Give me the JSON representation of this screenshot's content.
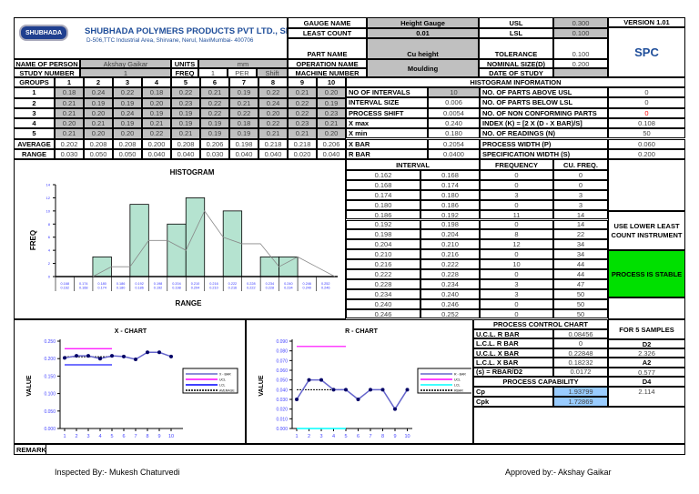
{
  "header": {
    "logo_text": "SHUBHADA",
    "company": "SHUBHADA POLYMERS PRODUCTS PVT LTD., SHIRWANE",
    "address": "D-506,TTC Industrial Area, Shirvane, Nerul, NaviMumbai- 400706",
    "name_of_person_label": "NAME OF PERSON",
    "name_of_person": "Akshay Gaikar",
    "units_label": "UNITS",
    "units": "mm",
    "study_number_label": "STUDY NUMBER",
    "study_number": "1",
    "freq_label": "FREQ",
    "freq": "1",
    "per_label": "PER",
    "per": "Shift",
    "gauge_name_label": "GAUGE NAME",
    "gauge_name": "Height Gauge",
    "least_count_label": "LEAST COUNT",
    "least_count": "0.01",
    "part_name_label": "PART NAME",
    "part_name": "Cu height",
    "operation_name_label": "OPERATION NAME",
    "machine_number_label": "MACHINE NUMBER",
    "operation_name": "Moulding",
    "usl_label": "USL",
    "usl": "0.300",
    "lsl_label": "LSL",
    "lsl": "0.100",
    "tolerance_label": "TOLERANCE",
    "tolerance": "0.100",
    "nominal_label": "NOMINAL SIZE(D)",
    "nominal": "0.200",
    "date_label": "DATE OF STUDY",
    "version": "VERSION 1.01",
    "spc": "SPC"
  },
  "groups": {
    "label": "GROUPS",
    "columns": [
      "1",
      "2",
      "3",
      "4",
      "5",
      "6",
      "7",
      "8",
      "9",
      "10"
    ],
    "rows": [
      {
        "label": "1",
        "values": [
          "0.18",
          "0.24",
          "0.22",
          "0.18",
          "0.22",
          "0.21",
          "0.19",
          "0.22",
          "0.21",
          "0.20"
        ]
      },
      {
        "label": "2",
        "values": [
          "0.21",
          "0.19",
          "0.19",
          "0.20",
          "0.23",
          "0.22",
          "0.21",
          "0.24",
          "0.22",
          "0.19"
        ]
      },
      {
        "label": "3",
        "values": [
          "0.21",
          "0.20",
          "0.24",
          "0.19",
          "0.19",
          "0.22",
          "0.22",
          "0.20",
          "0.22",
          "0.23"
        ]
      },
      {
        "label": "4",
        "values": [
          "0.20",
          "0.21",
          "0.19",
          "0.21",
          "0.19",
          "0.19",
          "0.18",
          "0.22",
          "0.23",
          "0.21"
        ]
      },
      {
        "label": "5",
        "values": [
          "0.21",
          "0.20",
          "0.20",
          "0.22",
          "0.21",
          "0.19",
          "0.19",
          "0.21",
          "0.21",
          "0.20"
        ]
      }
    ],
    "average": {
      "label": "AVERAGE",
      "values": [
        "0.202",
        "0.208",
        "0.208",
        "0.200",
        "0.208",
        "0.206",
        "0.198",
        "0.218",
        "0.218",
        "0.206"
      ]
    },
    "range": {
      "label": "RANGE",
      "values": [
        "0.030",
        "0.050",
        "0.050",
        "0.040",
        "0.040",
        "0.030",
        "0.040",
        "0.040",
        "0.020",
        "0.040"
      ]
    }
  },
  "hist_info": {
    "title": "HISTOGRAM INFORMATION",
    "left": [
      {
        "label": "NO OF INTERVALS",
        "value": "10"
      },
      {
        "label": "INTERVAL SIZE",
        "value": "0.006"
      },
      {
        "label": "PROCESS SHIFT",
        "value": "0.0054"
      },
      {
        "label": "X max",
        "value": "0.240"
      },
      {
        "label": "X min",
        "value": "0.180"
      },
      {
        "label": "X BAR",
        "value": "0.2054"
      },
      {
        "label": "R BAR",
        "value": "0.0400"
      }
    ],
    "right": [
      {
        "label": "NO. OF PARTS ABOVE USL",
        "value": "0"
      },
      {
        "label": "NO. OF PARTS BELOW LSL",
        "value": "0"
      },
      {
        "label": "NO. OF NON CONFORMING PARTS",
        "value": "0"
      },
      {
        "label": "INDEX (K) = [2 X (D - X BAR)/S]",
        "value": "0.108"
      },
      {
        "label": "NO. OF READINGS (N)",
        "value": "50"
      },
      {
        "label": "PROCESS WIDTH (P)",
        "value": "0.060"
      },
      {
        "label": "SPECIFICATION WIDTH (S)",
        "value": "0.200"
      }
    ]
  },
  "intervals": {
    "headers": [
      "INTERVAL",
      "FREQUENCY",
      "CU. FREQ."
    ],
    "rows": [
      [
        "0.162",
        "0.168",
        "0",
        "0"
      ],
      [
        "0.168",
        "0.174",
        "0",
        "0"
      ],
      [
        "0.174",
        "0.180",
        "3",
        "3"
      ],
      [
        "0.180",
        "0.186",
        "0",
        "3"
      ],
      [
        "0.186",
        "0.192",
        "11",
        "14"
      ],
      [
        "0.192",
        "0.198",
        "0",
        "14"
      ],
      [
        "0.198",
        "0.204",
        "8",
        "22"
      ],
      [
        "0.204",
        "0.210",
        "12",
        "34"
      ],
      [
        "0.210",
        "0.216",
        "0",
        "34"
      ],
      [
        "0.216",
        "0.222",
        "10",
        "44"
      ],
      [
        "0.222",
        "0.228",
        "0",
        "44"
      ],
      [
        "0.228",
        "0.234",
        "3",
        "47"
      ],
      [
        "0.234",
        "0.240",
        "3",
        "50"
      ],
      [
        "0.240",
        "0.246",
        "0",
        "50"
      ],
      [
        "0.246",
        "0.252",
        "0",
        "50"
      ]
    ]
  },
  "status": {
    "instrument": "USE LOWER LEAST COUNT INSTRUMENT",
    "stable": "PROCESS IS STABLE",
    "stable_color": "#00e000",
    "highlight_color": "#99ccff",
    "alert_color": "#ff0000"
  },
  "control": {
    "title": "PROCESS CONTROL CHART",
    "samples": "FOR 5 SAMPLES",
    "rows": [
      {
        "label": "U.C.L. R BAR",
        "value": "0.08456"
      },
      {
        "label": "L.C.L. R BAR",
        "value": "0"
      },
      {
        "label": "U.C.L. X BAR",
        "value": "0.22848"
      },
      {
        "label": "L.C.L. X BAR",
        "value": "0.18232"
      },
      {
        "label": "(s) = RBAR/D2",
        "value": "0.0172"
      }
    ],
    "capability_title": "PROCESS CAPABILITY",
    "cp_label": "Cp",
    "cp": "1.93799",
    "cpk_label": "Cpk",
    "cpk": "1.72869",
    "d2_label": "D2",
    "d2": "2.326",
    "a2_label": "A2",
    "a2": "0.577",
    "d4_label": "D4",
    "d4": "2.114"
  },
  "footer": {
    "remarks": "REMARKS",
    "inspected": "Inspected By:- Mukesh Chaturvedi",
    "approved": "Approved by:- Akshay Gaikar"
  },
  "chart_data": [
    {
      "type": "bar",
      "title": "HISTOGRAM",
      "xlabel": "RANGE",
      "ylabel": "FREQ",
      "ylim": [
        0,
        14
      ],
      "yticks": [
        "0",
        "2",
        "4",
        "6",
        "8",
        "10",
        "12",
        "14"
      ],
      "categories": [
        [
          "0.168",
          "0.162"
        ],
        [
          "0.174",
          "0.168"
        ],
        [
          "0.180",
          "0.174"
        ],
        [
          "0.186",
          "0.180"
        ],
        [
          "0.192",
          "0.186"
        ],
        [
          "0.198",
          "0.192"
        ],
        [
          "0.204",
          "0.198"
        ],
        [
          "0.210",
          "0.204"
        ],
        [
          "0.216",
          "0.210"
        ],
        [
          "0.222",
          "0.216"
        ],
        [
          "0.228",
          "0.222"
        ],
        [
          "0.234",
          "0.228"
        ],
        [
          "0.240",
          "0.234"
        ],
        [
          "0.246",
          "0.240"
        ],
        [
          "0.252",
          "0.246"
        ]
      ],
      "values": [
        0,
        0,
        3,
        0,
        11,
        0,
        8,
        12,
        0,
        10,
        0,
        3,
        3,
        0,
        0
      ],
      "trend": "2-period moving average"
    },
    {
      "type": "line",
      "title": "X - CHART",
      "ylabel": "VALUE",
      "ylim": [
        0,
        0.25
      ],
      "yticks": [
        "0.000",
        "0.050",
        "0.100",
        "0.150",
        "0.200",
        "0.250"
      ],
      "x": [
        "1",
        "2",
        "3",
        "4",
        "5",
        "6",
        "7",
        "8",
        "9",
        "10"
      ],
      "series": [
        {
          "name": "X - BAR",
          "values": [
            0.202,
            0.208,
            0.208,
            0.2,
            0.208,
            0.206,
            0.198,
            0.218,
            0.218,
            0.206
          ]
        }
      ],
      "ucl": {
        "name": "UCL",
        "value": 0.22848
      },
      "lcl": {
        "name": "LCL",
        "value": 0.18232
      },
      "avg": {
        "name": "AVERAGE",
        "value": 0.2054
      },
      "legend": "right"
    },
    {
      "type": "line",
      "title": "R - CHART",
      "ylabel": "VALUE",
      "ylim": [
        0,
        0.09
      ],
      "yticks": [
        "0.000",
        "0.010",
        "0.020",
        "0.030",
        "0.040",
        "0.050",
        "0.060",
        "0.070",
        "0.080",
        "0.090"
      ],
      "x": [
        "1",
        "2",
        "3",
        "4",
        "5",
        "6",
        "7",
        "8",
        "9",
        "10"
      ],
      "series": [
        {
          "name": "R - BAR",
          "values": [
            0.03,
            0.05,
            0.05,
            0.04,
            0.04,
            0.03,
            0.04,
            0.04,
            0.02,
            0.04
          ]
        }
      ],
      "ucl": {
        "name": "UCL",
        "value": 0.08456
      },
      "lcl": {
        "name": "LCL",
        "value": 0
      },
      "avg": {
        "name": "RBAR",
        "value": 0.04
      },
      "legend": "right"
    }
  ]
}
